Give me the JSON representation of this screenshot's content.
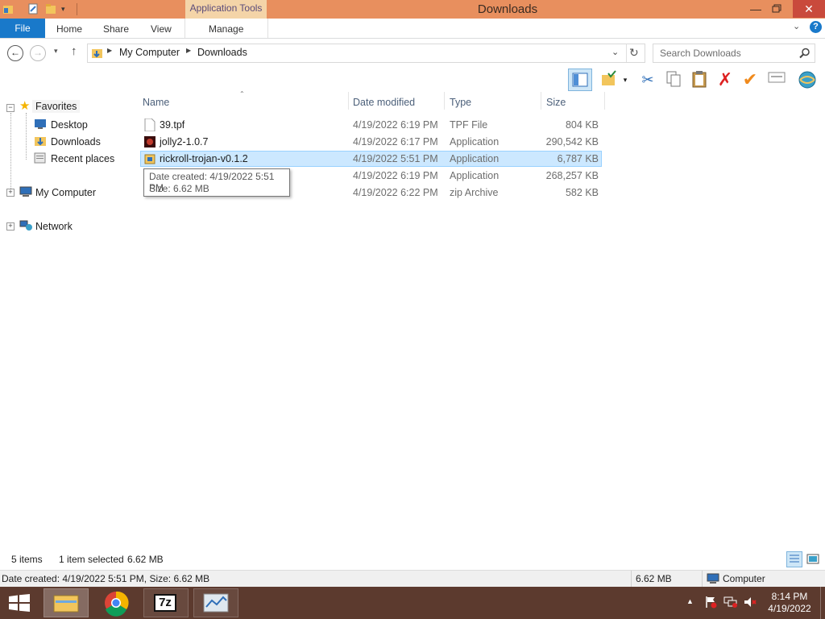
{
  "window": {
    "title": "Downloads"
  },
  "ribbon": {
    "context_tab": "Application Tools",
    "tabs": [
      "File",
      "Home",
      "Share",
      "View",
      "Manage"
    ]
  },
  "address": {
    "path": [
      "My Computer",
      "Downloads"
    ],
    "search_placeholder": "Search Downloads"
  },
  "nav": {
    "favorites": "Favorites",
    "desktop": "Desktop",
    "downloads": "Downloads",
    "recent": "Recent places",
    "my_computer": "My Computer",
    "network": "Network"
  },
  "columns": {
    "name": "Name",
    "date": "Date modified",
    "type": "Type",
    "size": "Size"
  },
  "files": [
    {
      "name": "39.tpf",
      "date": "4/19/2022 6:19 PM",
      "type": "TPF File",
      "size": "804 KB"
    },
    {
      "name": "jolly2-1.0.7",
      "date": "4/19/2022 6:17 PM",
      "type": "Application",
      "size": "290,542 KB"
    },
    {
      "name": "rickroll-trojan-v0.1.2",
      "date": "4/19/2022 5:51 PM",
      "type": "Application",
      "size": "6,787 KB"
    },
    {
      "name": "",
      "date": "4/19/2022 6:19 PM",
      "type": "Application",
      "size": "268,257 KB"
    },
    {
      "name": "",
      "date": "4/19/2022 6:22 PM",
      "type": "zip Archive",
      "size": "582 KB"
    }
  ],
  "tooltip": {
    "line1": "Date created: 4/19/2022 5:51 PM",
    "line2": "Size: 6.62 MB"
  },
  "status": {
    "items": "5 items",
    "selected": "1 item selected",
    "selected_size": "6.62 MB"
  },
  "details": {
    "text": "Date created: 4/19/2022 5:51 PM, Size: 6.62 MB",
    "size": "6.62 MB",
    "location": "Computer"
  },
  "taskbar": {
    "time": "8:14 PM",
    "date": "4/19/2022",
    "sevenzip_label": "7z"
  },
  "colors": {
    "titlebar": "#e88f5e",
    "file_tab": "#1979ca",
    "taskbar": "#5c3a2e",
    "selection": "#cce8ff"
  }
}
